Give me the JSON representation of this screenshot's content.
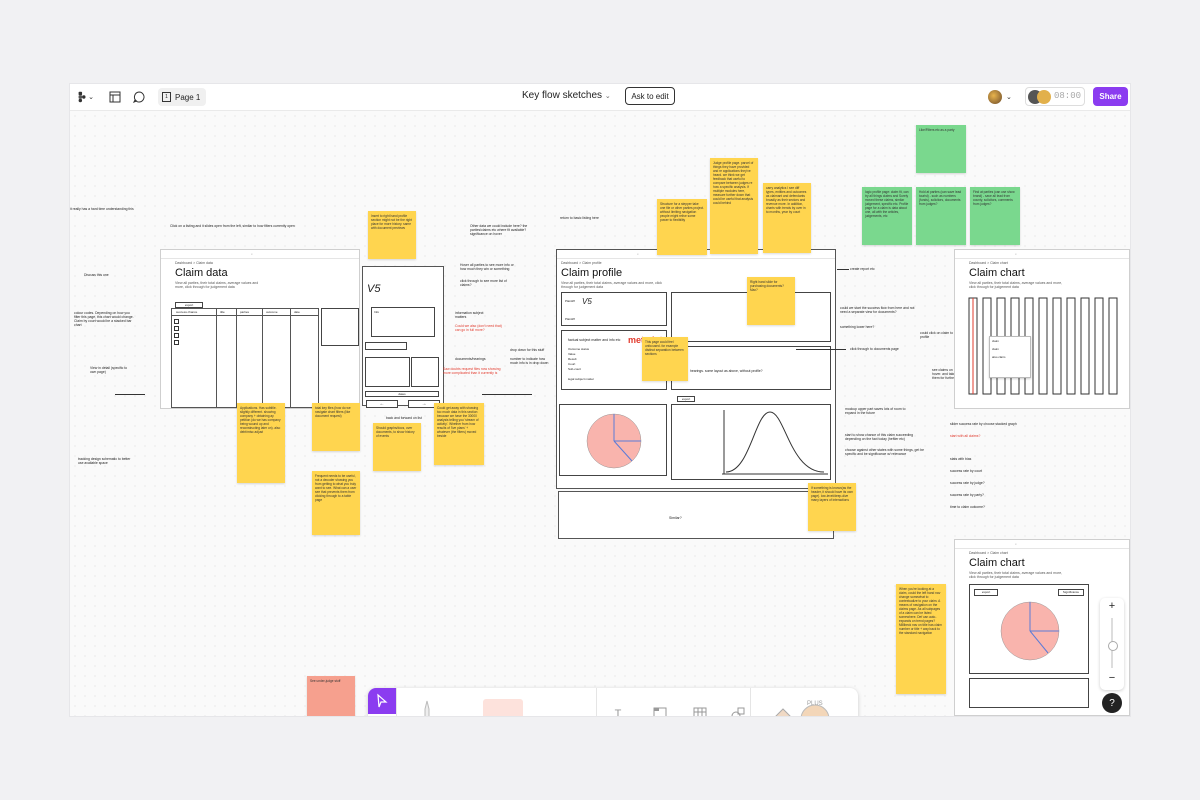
{
  "header": {
    "page_label": "Page 1",
    "file_title": "Key flow sketches",
    "ask_button": "Ask to edit",
    "timer": "08:00",
    "share_button": "Share"
  },
  "frames": {
    "claim_data": {
      "title": "Claim data",
      "subtitle": "View all parties, their total claims, average values and more, click through for judgement data",
      "export": "export",
      "columns": [
        "success chance",
        "title",
        "parties",
        "outcome",
        "date"
      ],
      "nav": "Dashboard > Claim data"
    },
    "claim_profile": {
      "title": "Claim profile",
      "subtitle": "View all parties, their total claims, average values and more, click through for judgement data",
      "metadata": "metadata",
      "factual": "factual subject matter and info etc",
      "fields": [
        "Outcome status",
        "Value",
        "Result",
        "Court",
        "Sub-court",
        "legal subject matter"
      ],
      "name_labels": [
        "Plaintiff",
        "Plaintiff"
      ],
      "export": "export",
      "bottom_label": "Similar?",
      "nav": "Dashboard > Claim profile"
    },
    "claim_chart_1": {
      "title": "Claim chart",
      "subtitle": "View all parties, their total claims, average values and more, click through for judgement data",
      "labels": [
        "claim",
        "claim",
        "also claim"
      ],
      "nav": "Dashboard > Claim chart"
    },
    "claim_chart_2": {
      "title": "Claim chart",
      "subtitle": "View all parties, their total claims, average values and more, click through for judgement data",
      "export": "export",
      "significance": "Significance",
      "nav": "Dashboard > Claim chart"
    }
  },
  "stickies": {
    "s1": "Insert to right hand profile section might not be the right place for more history. same with document previews",
    "s2": "Applications. Has subtitle. slightly different. showing company + obtaining ay petition (do we has company being wound up and reconstructing later on). also debt/misc adjust",
    "s3": "total key files (how do we navigate chart filters (like document request)",
    "s4": "Frequent needs to be useful, not a decoder showing you from getting to what you truly want to see. What can a user see that prevents them from clicking through to a table page",
    "s5": "Should graphs/docs, over documents, to show history of events",
    "s6": "Could get away with showing too much data in this section because we have the 30000 analysis telling you 'stream of activity'. Whether from how results of 'live plans' + whatever (the filters) moved beside",
    "s7": "Structure for a stepper take one file or other parties project. without limiting navigation people might relive some power to flexibility",
    "s8": "Judge profile page. parcel of things they have provided and re applications they've heard. we think we get feedback that useful to compare between judges re how a specific analysis. If multiple modules here, measure further down that could be useful that analysis could behind",
    "s9": "carry analytics I see diff types, entities and outcomes as claimant and defendants broadly as their sectors and revenue more. In addition, charts with trends by over in to months, year by court",
    "s10": "Right hand slide for purchasing documents? Max?",
    "s11": "This page could feel unfocused. for example distinct separation between sections",
    "s12": "If something is known(as the header, it should have its own page). low-level/deep-dive many layers of interactions",
    "s13": "When you're looking at a claim, could the left hand nav change somewhat to contextualize to your claim. A means of navigation on the claims page. As all subpages of a claim can be listed somewhere. Def can auto-expands on trend pages? Millibeck nav on title has claim number or title + way back to the standard navigation",
    "g1": "Like/Filters etc as a party",
    "g2": "logic profile page: claim fit, can try all things claims and Surely moved these claims, similar judgement, specific etc. Profile page for a claim is data about one, all with the articles, judgements, etc",
    "g3": "Hold at parties (can save lead tourist) - such as numbers (funds), solicitors, documents from judges?",
    "g4": "Find at parties (can use show brand) - save all lead from county, solicitors, comments from judges?",
    "pink": "See under-judge stuff"
  },
  "annotations": {
    "a_left1": "it really has a hard time understanding this",
    "a_click": "Click on a listing and it slides open from the left, similar to how filters currently open",
    "a_discuss": "Discuss this one",
    "a_colour": "colour codes. Depending on how you filter this page, this chart would change. Claim by court would be a stacked bar chart",
    "a_view": "View in detail (specific to own page)",
    "a_tracking": "tracking design schematic to better use available space",
    "a_other": "Other data we could include here? the parties/claims etc where fit available? significance on hover",
    "a_hover": "Hover all parties to see more info or how much they win or something",
    "a_click_through": "click through to see more list of claims?",
    "a_info": "information subject matters",
    "a_red1": "Could we also (don't need that) can go in full more?",
    "a_docs": "documents/hearings",
    "a_red2": "Saw doubts request files now showing more complicated than it currently is",
    "a_back": "back and forward on list",
    "a_drop": "drop down for this stuff",
    "a_number": "number to indicate how much info is in drop down",
    "a_return": "return to basic listing here",
    "a_create": "create report etc",
    "a_could": "could we start the success flow from here and not need a separate view for documents?",
    "a_lower": "something lower here?",
    "a_link": "could click on claim to see profile",
    "a_click_docs": "click through to documents page",
    "a_hearings": "hearings. some layout as above, without profile?",
    "a_see": "see claims on hover. and take them for further",
    "a_mockup": "mockup upper part saves lots of room to expand in the future",
    "a_start": "start to show chance of this claim succeeding depending on the fact today (heftier etc)",
    "a_choose": "choose against other states with some things, get be specific and be significance w/ relevance",
    "a_slider": "slider success rate by choose stacked graph",
    "a_red3": "start with all claims?",
    "a_stats": [
      "stats with bias",
      "success rate by court",
      "success rate by judge?",
      "success rate by party?",
      "time to claim outcome?"
    ]
  },
  "zoom": {
    "plus": "+",
    "minus": "−"
  },
  "help": "?"
}
